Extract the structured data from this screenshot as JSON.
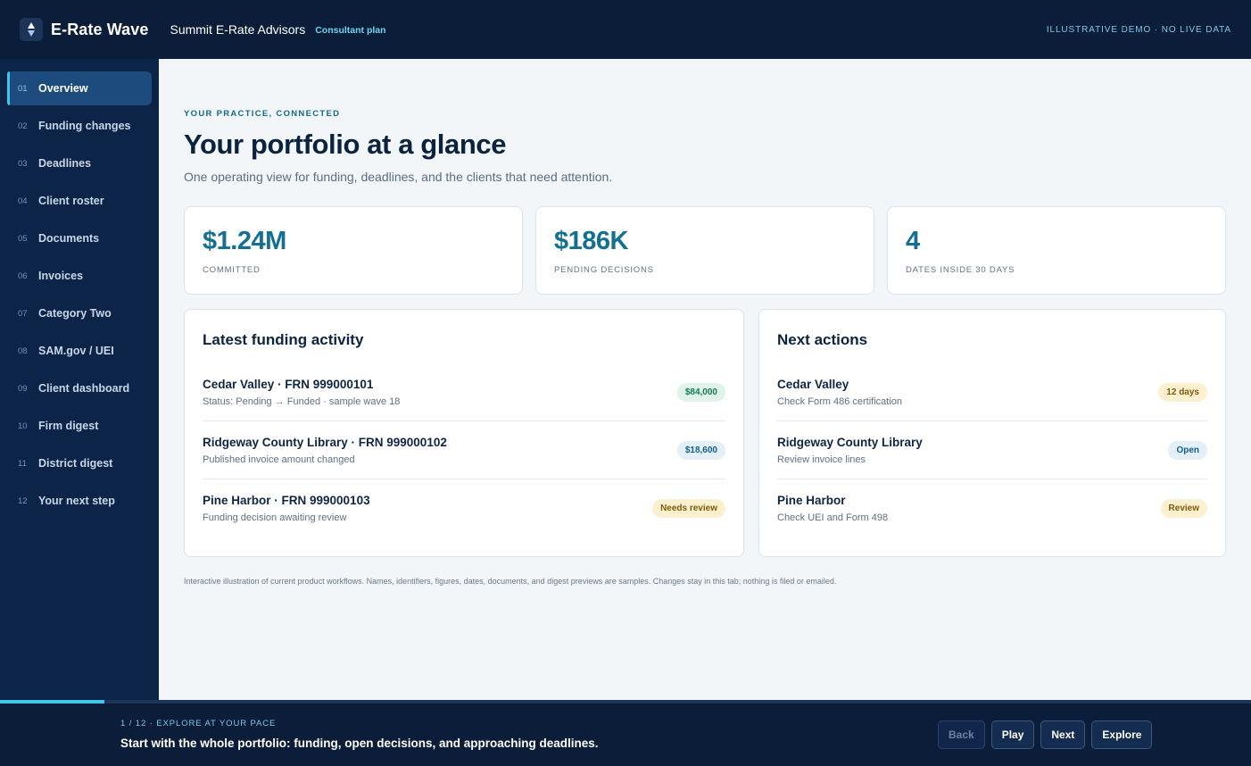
{
  "header": {
    "brand": "E-Rate Wave",
    "org": "Summit E-Rate Advisors",
    "plan": "Consultant plan",
    "demo_flag": "ILLUSTRATIVE DEMO · NO LIVE DATA"
  },
  "sidebar": {
    "active_index": 0,
    "items": [
      {
        "num": "01",
        "label": "Overview"
      },
      {
        "num": "02",
        "label": "Funding changes"
      },
      {
        "num": "03",
        "label": "Deadlines"
      },
      {
        "num": "04",
        "label": "Client roster"
      },
      {
        "num": "05",
        "label": "Documents"
      },
      {
        "num": "06",
        "label": "Invoices"
      },
      {
        "num": "07",
        "label": "Category Two"
      },
      {
        "num": "08",
        "label": "SAM.gov / UEI"
      },
      {
        "num": "09",
        "label": "Client dashboard"
      },
      {
        "num": "10",
        "label": "Firm digest"
      },
      {
        "num": "11",
        "label": "District digest"
      },
      {
        "num": "12",
        "label": "Your next step"
      }
    ]
  },
  "main": {
    "eyebrow": "YOUR PRACTICE, CONNECTED",
    "title": "Your portfolio at a glance",
    "subtitle": "One operating view for funding, deadlines, and the clients that need attention.",
    "stats": [
      {
        "value": "$1.24M",
        "label": "COMMITTED"
      },
      {
        "value": "$186K",
        "label": "PENDING DECISIONS"
      },
      {
        "value": "4",
        "label": "DATES INSIDE 30 DAYS"
      }
    ],
    "funding": {
      "title": "Latest funding activity",
      "rows": [
        {
          "main": "Cedar Valley · FRN 999000101",
          "sub": "Status: Pending → Funded · sample wave 18",
          "badge": "$84,000",
          "tone": "green"
        },
        {
          "main": "Ridgeway County Library · FRN 999000102",
          "sub": "Published invoice amount changed",
          "badge": "$18,600",
          "tone": "blue"
        },
        {
          "main": "Pine Harbor · FRN 999000103",
          "sub": "Funding decision awaiting review",
          "badge": "Needs review",
          "tone": "amber"
        }
      ]
    },
    "actions": {
      "title": "Next actions",
      "rows": [
        {
          "main": "Cedar Valley",
          "sub": "Check Form 486 certification",
          "badge": "12 days",
          "tone": "amber"
        },
        {
          "main": "Ridgeway County Library",
          "sub": "Review invoice lines",
          "badge": "Open",
          "tone": "blue"
        },
        {
          "main": "Pine Harbor",
          "sub": "Check UEI and Form 498",
          "badge": "Review",
          "tone": "amber"
        }
      ]
    },
    "footnote": "Interactive illustration of current product workflows. Names, identifiers, figures, dates, documents, and digest previews are samples. Changes stay in this tab; nothing is filed or emailed."
  },
  "footer": {
    "progress": 0.0833,
    "step_meta": "1 / 12 · EXPLORE AT YOUR PACE",
    "step_text": "Start with the whole portfolio: funding, open decisions, and approaching deadlines.",
    "buttons": {
      "back": "Back",
      "play": "Play",
      "next": "Next",
      "explore": "Explore"
    }
  },
  "colors": {
    "topbar": "#0b1d38",
    "sidebar": "#0c2447",
    "accent": "#41c5ea",
    "stat_value": "#137093",
    "background": "#f2f6f9"
  },
  "icons": {
    "logo": "wave-diamond-icon"
  }
}
